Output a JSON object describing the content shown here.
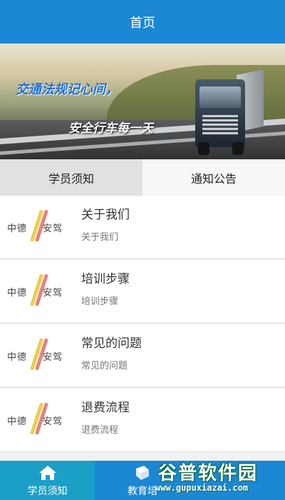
{
  "header": {
    "title": "首页"
  },
  "banner": {
    "slogan_line1": "交通法规记心间，",
    "slogan_line2": "安全行车每一天"
  },
  "tabs": [
    {
      "label": "学员须知",
      "active": true
    },
    {
      "label": "通知公告",
      "active": false
    }
  ],
  "list": [
    {
      "logo_text": [
        "中德",
        "安驾"
      ],
      "title": "关于我们",
      "subtitle": "关于我们"
    },
    {
      "logo_text": [
        "中德",
        "安驾"
      ],
      "title": "培训步骤",
      "subtitle": "培训步骤"
    },
    {
      "logo_text": [
        "中德",
        "安驾"
      ],
      "title": "常见的问题",
      "subtitle": "常见的问题"
    },
    {
      "logo_text": [
        "中德",
        "安驾"
      ],
      "title": "退费流程",
      "subtitle": "退费流程"
    }
  ],
  "bottom_nav": [
    {
      "label": "学员须知",
      "icon": "home-icon",
      "active": true
    },
    {
      "label": "教育培",
      "icon": "book-icon",
      "active": false
    }
  ],
  "watermark": {
    "name": "谷普软件园",
    "url": "www.gupuxiazai.com"
  },
  "colors": {
    "primary": "#1c87d4",
    "active_nav": "#1c9fc6",
    "tab_active": "#e1e1e1"
  }
}
